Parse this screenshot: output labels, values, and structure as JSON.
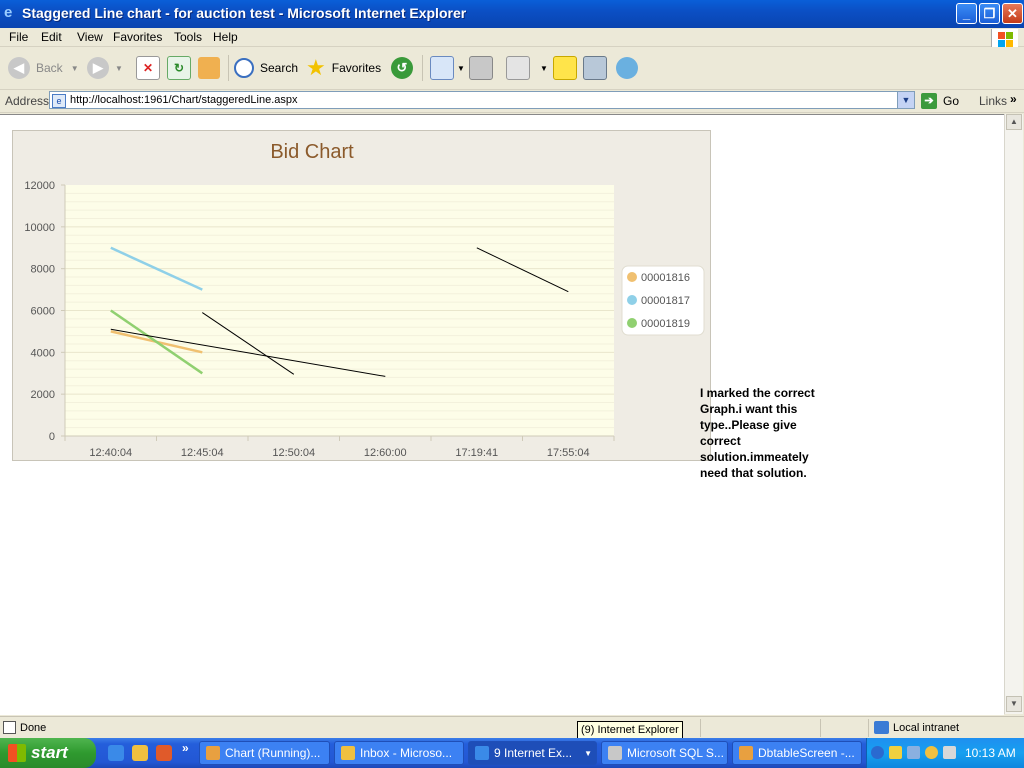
{
  "window": {
    "title": "Staggered Line chart - for auction test - Microsoft Internet Explorer"
  },
  "menu": [
    "File",
    "Edit",
    "View",
    "Favorites",
    "Tools",
    "Help"
  ],
  "toolbar": {
    "back_label": "Back",
    "search_label": "Search",
    "favorites_label": "Favorites"
  },
  "address": {
    "label": "Address",
    "url": "http://localhost:1961/Chart/staggeredLine.aspx",
    "go_label": "Go",
    "links_label": "Links"
  },
  "chart_data": {
    "type": "line",
    "title": "Bid Chart",
    "categories": [
      "12:40:04",
      "12:45:04",
      "12:50:04",
      "12:60:00",
      "17:19:41",
      "17:55:04"
    ],
    "yticks": [
      "0",
      "2000",
      "4000",
      "6000",
      "8000",
      "10000",
      "12000"
    ],
    "ylim": [
      0,
      12000
    ],
    "grid": true,
    "legend_position": "right",
    "series": [
      {
        "name": "00001816",
        "color": "#f0c070",
        "points": [
          [
            0,
            5000
          ],
          [
            1,
            4000
          ]
        ]
      },
      {
        "name": "00001817",
        "color": "#8fd0e8",
        "points": [
          [
            0,
            9000
          ],
          [
            1,
            7000
          ]
        ]
      },
      {
        "name": "00001819",
        "color": "#90d070",
        "points": [
          [
            0,
            6000
          ],
          [
            1,
            3000
          ]
        ]
      }
    ],
    "unlabeled_lines": [
      {
        "color": "#000000",
        "points": [
          [
            0,
            5100
          ],
          [
            3,
            2850
          ]
        ]
      },
      {
        "color": "#000000",
        "points": [
          [
            1,
            5900
          ],
          [
            2,
            2950
          ]
        ]
      },
      {
        "color": "#000000",
        "points": [
          [
            4,
            9000
          ],
          [
            5,
            6900
          ]
        ]
      }
    ]
  },
  "note": "I marked the correct Graph.i want this type..Please  give correct solution.immeately need that solution.",
  "status": {
    "text": "Done",
    "zone": "Local intranet"
  },
  "tooltip": "(9) Internet Explorer",
  "taskbar": {
    "start_label": "start",
    "tasks": [
      "Chart (Running)...",
      "Inbox - Microso...",
      "9 Internet Ex...",
      "Microsoft SQL S...",
      "DbtableScreen -..."
    ],
    "clock": "10:13 AM"
  }
}
